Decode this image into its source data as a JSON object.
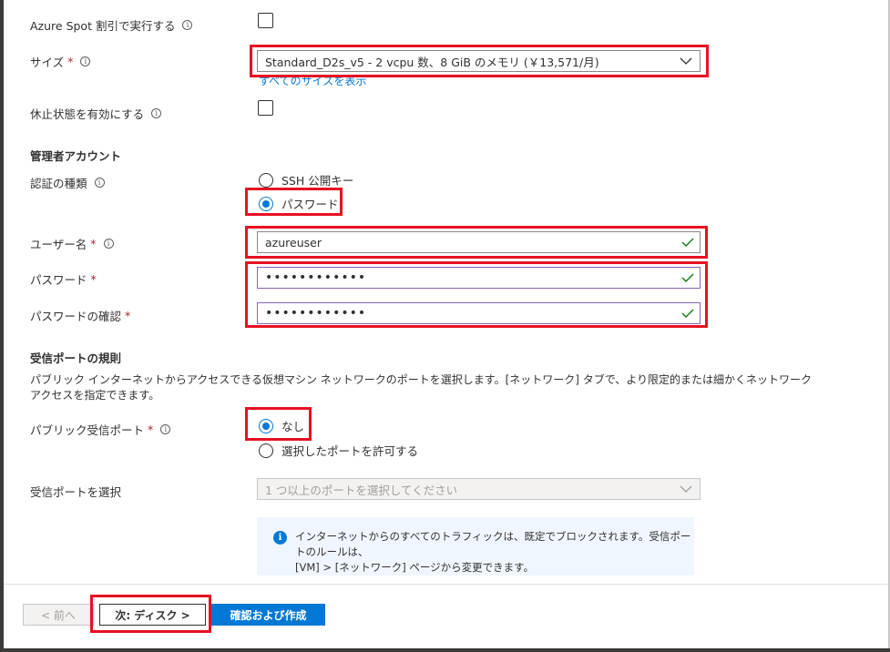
{
  "spot": {
    "label": "Azure Spot 割引で実行する"
  },
  "size": {
    "label": "サイズ",
    "required": "*",
    "value": "Standard_D2s_v5 - 2 vcpu 数、8 GiB のメモリ (￥13,571/月)",
    "link": "すべてのサイズを表示"
  },
  "hibernate": {
    "label": "休止状態を有効にする"
  },
  "admin": {
    "heading": "管理者アカウント",
    "auth_label": "認証の種類",
    "auth_options": [
      "SSH 公開キー",
      "パスワード"
    ],
    "auth_selected": "パスワード",
    "username_label": "ユーザー名",
    "username_value": "azureuser",
    "password_label": "パスワード",
    "password_value": "••••••••••••",
    "confirm_label": "パスワードの確認",
    "confirm_value": "••••••••••••",
    "required": "*"
  },
  "ports": {
    "heading": "受信ポートの規則",
    "description_line1": "パブリック インターネットからアクセスできる仮想マシン ネットワークのポートを選択します。[ネットワーク] タブで、より限定的または細かくネットワーク",
    "description_line2": "アクセスを指定できます。",
    "public_label": "パブリック受信ポート",
    "required": "*",
    "options": [
      "なし",
      "選択したポートを許可する"
    ],
    "selected": "なし",
    "select_label": "受信ポートを選択",
    "select_placeholder": "1 つ以上のポートを選択してください",
    "info_line1": "インターネットからのすべてのトラフィックは、既定でブロックされます。受信ポートのルールは、",
    "info_line2": "[VM] > [ネットワーク] ページから変更できます。"
  },
  "footer": {
    "prev": "< 前へ",
    "next": "次: ディスク >",
    "review": "確認および作成"
  },
  "colors": {
    "accent": "#0078d4",
    "highlight": "#e81123",
    "required": "#a4262c"
  }
}
